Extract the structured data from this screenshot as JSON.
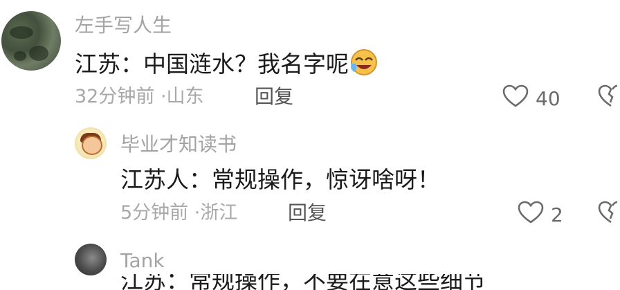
{
  "comments": [
    {
      "username": "左手写人生",
      "text": "江苏：中国涟水？我名字呢",
      "time": "32分钟前",
      "location": "山东",
      "reply_label": "回复",
      "likes": "40",
      "emoji": "laughing-crying-emoji"
    },
    {
      "username": "毕业才知读书",
      "text": "江苏人：常规操作，惊讶啥呀！",
      "time": "5分钟前",
      "location": "浙江",
      "reply_label": "回复",
      "likes": "2"
    },
    {
      "username": "Tank",
      "text": "江苏：常规操作，不要在意这些细节"
    }
  ],
  "separator": "·",
  "colors": {
    "username": "#a3a3a3",
    "text": "#1b1b1b",
    "meta": "#a8a8a8",
    "icon": "#6a6a6a"
  },
  "icons": [
    "heart-icon",
    "broken-heart-icon"
  ]
}
